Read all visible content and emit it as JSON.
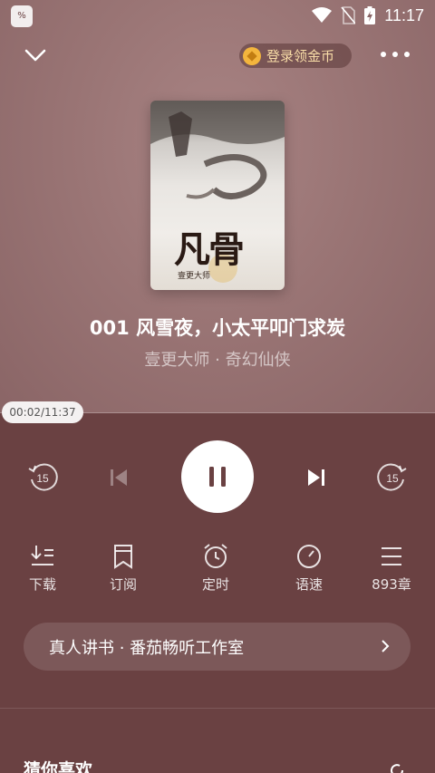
{
  "status_bar": {
    "time": "11:17"
  },
  "header": {
    "coin_label": "登录领金币"
  },
  "book": {
    "cover_title": "凡骨",
    "cover_author": "壹更大师",
    "chapter_title": "001 风雪夜，小太平叩门求炭",
    "meta": "壹更大师 · 奇幻仙侠"
  },
  "player": {
    "time_display": "00:02/11:37",
    "skip_back_seconds": "15",
    "skip_forward_seconds": "15",
    "state": "playing",
    "progress_fraction": 0.003
  },
  "features": [
    {
      "label": "下载",
      "icon": "download-icon"
    },
    {
      "label": "订阅",
      "icon": "bookmark-icon"
    },
    {
      "label": "定时",
      "icon": "alarm-clock-icon"
    },
    {
      "label": "语速",
      "icon": "speed-gauge-icon"
    },
    {
      "label": "893章",
      "icon": "list-icon"
    }
  ],
  "narrator": {
    "label": "真人讲书 · 番茄畅听工作室"
  },
  "recommend": {
    "title": "猜你喜欢"
  },
  "colors": {
    "background": "#6a4142",
    "accent_coin": "#f3b53d"
  }
}
